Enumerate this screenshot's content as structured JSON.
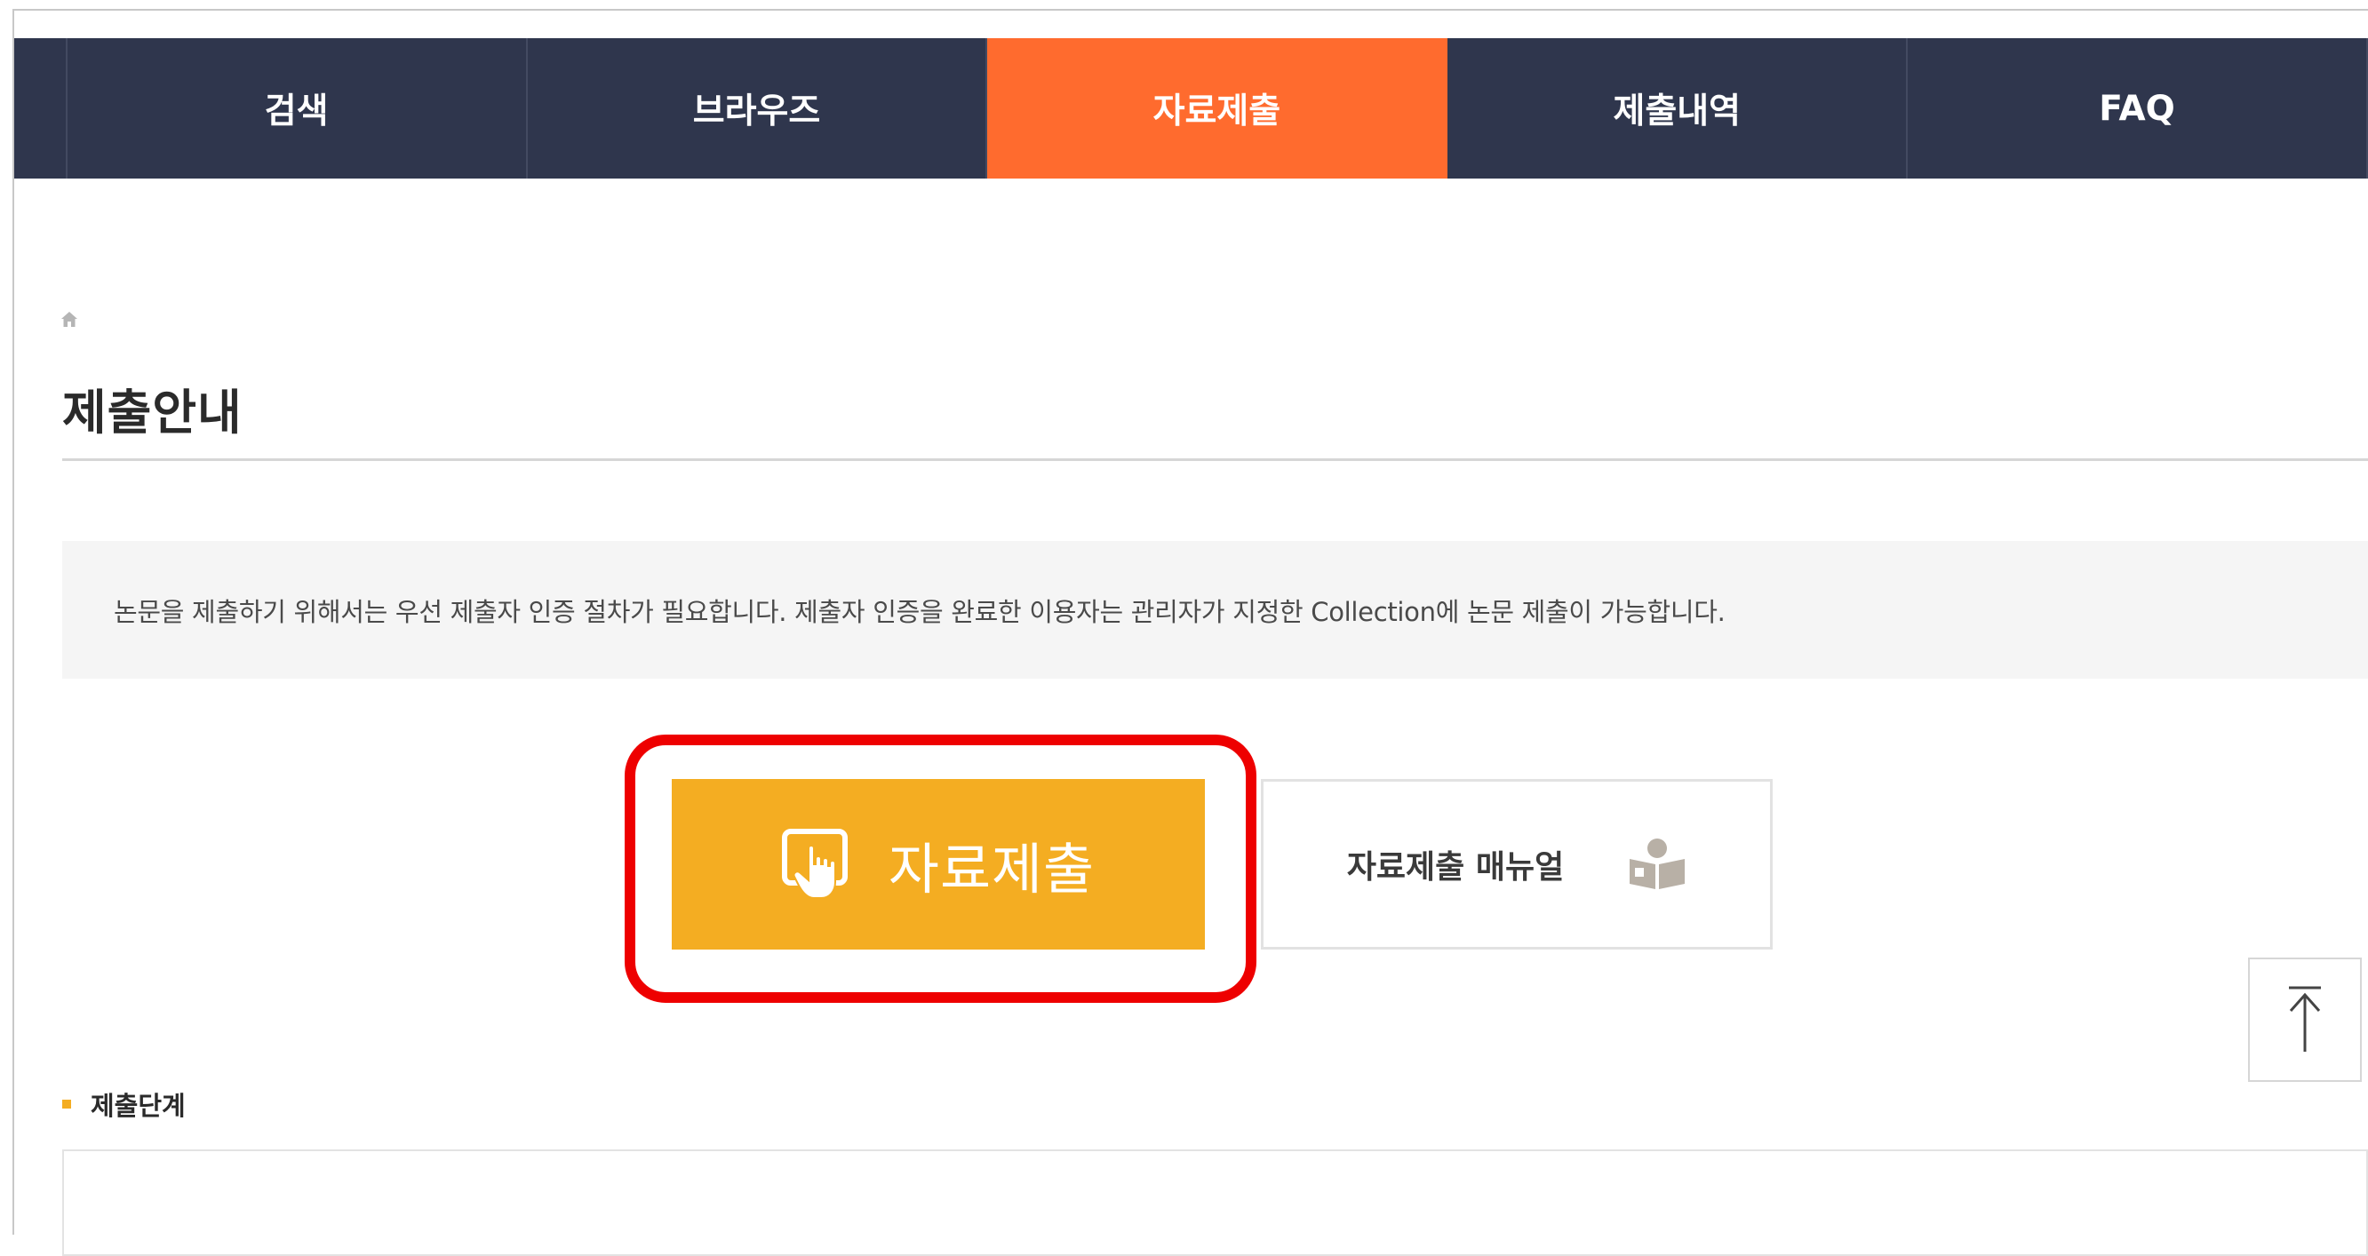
{
  "nav": {
    "tabs": [
      {
        "label": "검색"
      },
      {
        "label": "브라우즈"
      },
      {
        "label": "자료제출"
      },
      {
        "label": "제출내역"
      },
      {
        "label": "FAQ"
      }
    ],
    "active_tab": "자료제출"
  },
  "breadcrumb": {
    "icon": "home-icon"
  },
  "page": {
    "title": "제출안내"
  },
  "notice": {
    "text": "논문을 제출하기 위해서는 우선 제출자 인증 절차가 필요합니다. 제출자 인증을 완료한 이용자는 관리자가 지정한 Collection에 논문 제출이 가능합니다."
  },
  "buttons": {
    "submit_label": "자료제출",
    "submit_icon": "hand-pointer-icon",
    "manual_label": "자료제출 매뉴얼",
    "manual_icon": "reader-book-icon"
  },
  "scroll_top": {
    "icon": "arrow-up-icon"
  },
  "steps": {
    "heading": "제출단계"
  },
  "colors": {
    "nav_bg": "#2f364d",
    "nav_active": "#ff6b2e",
    "submit_bg": "#f4ad22",
    "highlight": "#ee0000"
  }
}
